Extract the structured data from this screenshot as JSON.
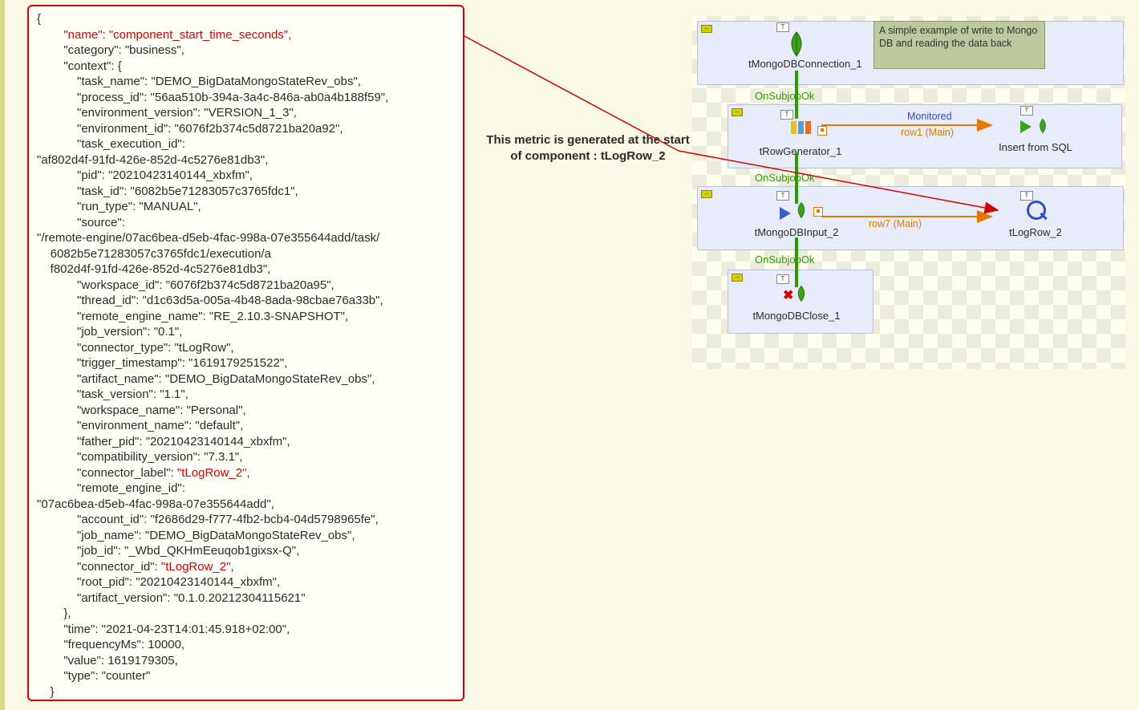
{
  "callout": {
    "line1": "This metric is generated at the start",
    "line2": "of component : tLogRow_2"
  },
  "diagram": {
    "comment": "A simple example of write to Mongo DB and reading the data back",
    "subjob_ok": "OnSubjobOk",
    "nodes": {
      "conn": "tMongoDBConnection_1",
      "rowgen": "tRowGenerator_1",
      "insert": "Insert from SQL",
      "input": "tMongoDBInput_2",
      "logrow": "tLogRow_2",
      "close": "tMongoDBClose_1"
    },
    "edges": {
      "monitored": "Monitored",
      "row1": "row1 (Main)",
      "row7": "row7 (Main)"
    }
  },
  "json_code": {
    "open": "{",
    "name_key": "        \"name\": ",
    "name_val": "\"component_start_time_seconds\",",
    "category": "        \"category\": \"business\",",
    "context_open": "        \"context\": {",
    "task_name": "            \"task_name\": \"DEMO_BigDataMongoStateRev_obs\",",
    "process_id": "            \"process_id\": \"56aa510b-394a-3a4c-846a-ab0a4b188f59\",",
    "env_ver": "            \"environment_version\": \"VERSION_1_3\",",
    "env_id": "            \"environment_id\": \"6076f2b374c5d8721ba20a92\",",
    "tex_key": "            \"task_execution_id\":",
    "tex_val": "\"af802d4f-91fd-426e-852d-4c5276e81db3\",",
    "pid": "            \"pid\": \"20210423140144_xbxfm\",",
    "task_id": "            \"task_id\": \"6082b5e71283057c3765fdc1\",",
    "run_type": "            \"run_type\": \"MANUAL\",",
    "source_key": "            \"source\":",
    "source_l1": "\"/remote-engine/07ac6bea-d5eb-4fac-998a-07e355644add/task/",
    "source_l2": "    6082b5e71283057c3765fdc1/execution/a",
    "source_l3": "    f802d4f-91fd-426e-852d-4c5276e81db3\",",
    "workspace_id": "            \"workspace_id\": \"6076f2b374c5d8721ba20a95\",",
    "thread_id": "            \"thread_id\": \"d1c63d5a-005a-4b48-8ada-98cbae76a33b\",",
    "re_name": "            \"remote_engine_name\": \"RE_2.10.3-SNAPSHOT\",",
    "job_ver": "            \"job_version\": \"0.1\",",
    "conn_type": "            \"connector_type\": \"tLogRow\",",
    "trigger_ts": "            \"trigger_timestamp\": \"1619179251522\",",
    "artifact_name": "            \"artifact_name\": \"DEMO_BigDataMongoStateRev_obs\",",
    "task_ver": "            \"task_version\": \"1.1\",",
    "ws_name": "            \"workspace_name\": \"Personal\",",
    "env_name": "            \"environment_name\": \"default\",",
    "father_pid": "            \"father_pid\": \"20210423140144_xbxfm\",",
    "compat_ver": "            \"compatibility_version\": \"7.3.1\",",
    "conn_label_key": "            \"connector_label\": ",
    "conn_label_val": "\"tLogRow_2\",",
    "reid_key": "            \"remote_engine_id\":",
    "reid_val": "\"07ac6bea-d5eb-4fac-998a-07e355644add\",",
    "account_id": "            \"account_id\": \"f2686d29-f777-4fb2-bcb4-04d5798965fe\",",
    "job_name": "            \"job_name\": \"DEMO_BigDataMongoStateRev_obs\",",
    "job_id": "            \"job_id\": \"_Wbd_QKHmEeuqob1gixsx-Q\",",
    "conn_id_key": "            \"connector_id\": ",
    "conn_id_val": "\"tLogRow_2\",",
    "root_pid": "            \"root_pid\": \"20210423140144_xbxfm\",",
    "artifact_ver": "            \"artifact_version\": \"0.1.0.20212304115621\"",
    "context_close": "        },",
    "time": "        \"time\": \"2021-04-23T14:01:45.918+02:00\",",
    "freq": "        \"frequencyMs\": 10000,",
    "value": "        \"value\": 1619179305,",
    "type": "        \"type\": \"counter\"",
    "close": "    }"
  }
}
